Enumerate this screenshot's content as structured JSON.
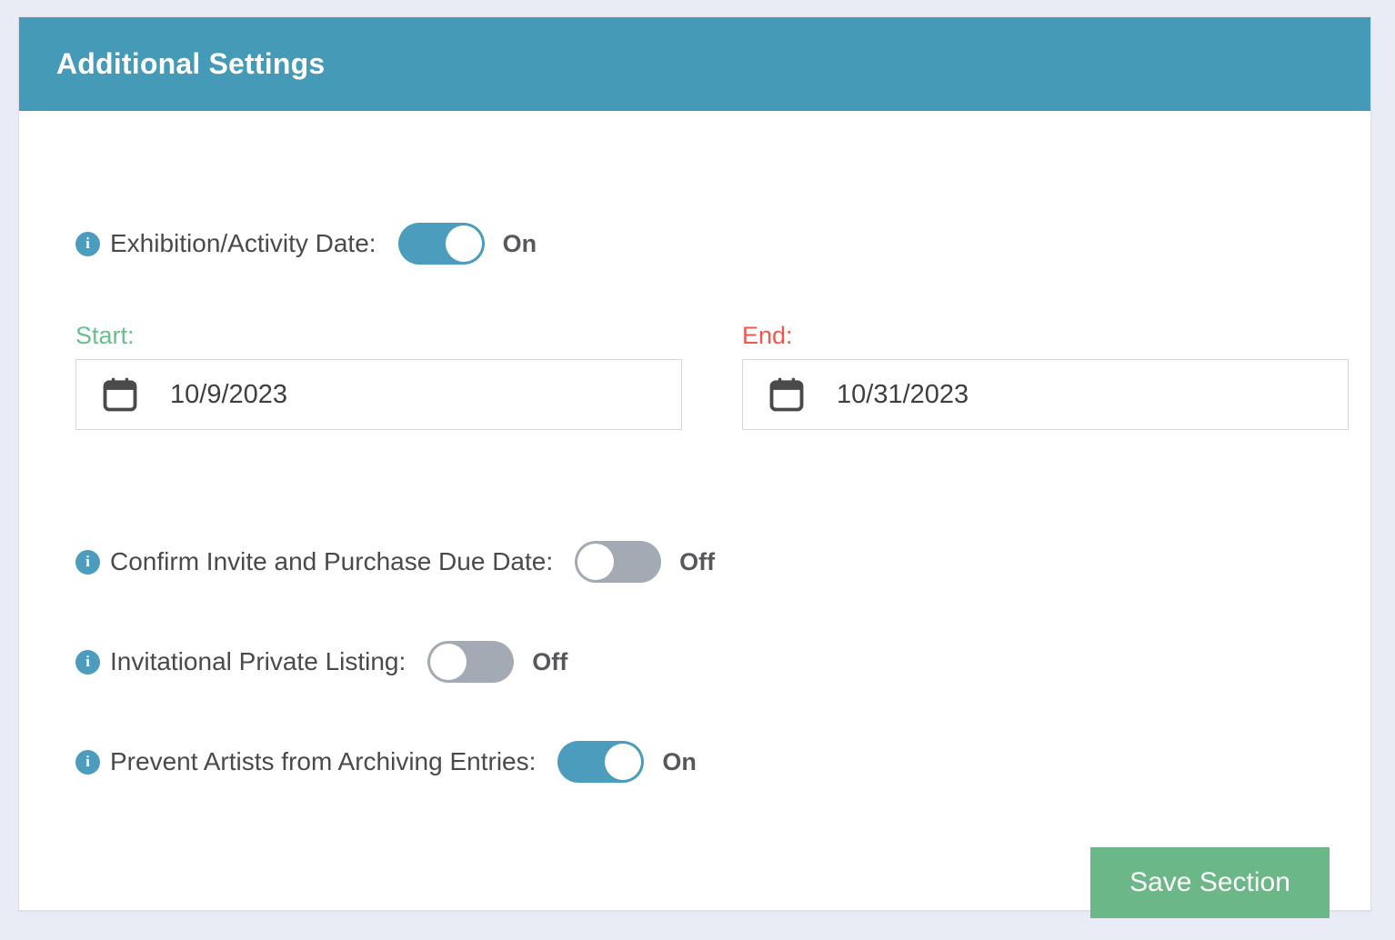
{
  "card": {
    "header_title": "Additional Settings"
  },
  "icons": {
    "info": "info-icon",
    "calendar": "calendar-icon"
  },
  "colors": {
    "header_bg": "#459ab8",
    "page_bg": "#e9ecf4",
    "accent_teal": "#4b9cbd",
    "toggle_off_gray": "#a4aab4",
    "save_green": "#6cb787",
    "start_label_green": "#68c18c",
    "end_label_red": "#f0584c"
  },
  "settings": {
    "exhibition_date": {
      "label": "Exhibition/Activity Date:",
      "state": "On",
      "info_glyph": "i"
    },
    "confirm_invite": {
      "label": "Confirm Invite and Purchase Due Date:",
      "state": "Off",
      "info_glyph": "i"
    },
    "invitational_listing": {
      "label": "Invitational Private Listing:",
      "state": "Off",
      "info_glyph": "i"
    },
    "prevent_archiving": {
      "label": "Prevent Artists from Archiving Entries:",
      "state": "On",
      "info_glyph": "i"
    }
  },
  "dates": {
    "start": {
      "label": "Start:",
      "value": "10/9/2023"
    },
    "end": {
      "label": "End:",
      "value": "10/31/2023"
    }
  },
  "actions": {
    "save_section": "Save Section"
  }
}
